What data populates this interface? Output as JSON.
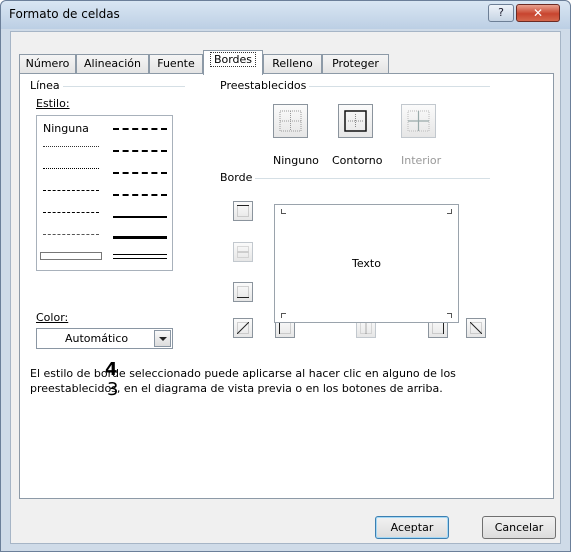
{
  "window": {
    "title": "Formato de celdas",
    "help_glyph": "?",
    "close_glyph": "✕"
  },
  "tabs": [
    {
      "label": "Número"
    },
    {
      "label": "Alineación"
    },
    {
      "label": "Fuente"
    },
    {
      "label": "Bordes",
      "active": true
    },
    {
      "label": "Relleno"
    },
    {
      "label": "Proteger"
    }
  ],
  "linea": {
    "group_label": "Línea",
    "estilo_label": "Estilo:",
    "none_label": "Ninguna",
    "color_label": "Color:",
    "color_value": "Automático"
  },
  "preestablecidos": {
    "group_label": "Preestablecidos",
    "buttons": [
      {
        "label": "Ninguno",
        "icon": "border-none-icon",
        "enabled": true
      },
      {
        "label": "Contorno",
        "icon": "border-outline-icon",
        "enabled": true
      },
      {
        "label": "Interior",
        "icon": "border-inside-icon",
        "enabled": false
      }
    ]
  },
  "borde": {
    "group_label": "Borde",
    "preview_text": "Texto"
  },
  "description": {
    "text": "El estilo de borde seleccionado puede aplicarse al hacer clic en alguno de los preestablecidos, en el diagrama de vista previa o en los botones de arriba."
  },
  "markers": {
    "a": "4",
    "b": "3"
  },
  "buttons": {
    "ok": "Aceptar",
    "cancel": "Cancelar"
  }
}
